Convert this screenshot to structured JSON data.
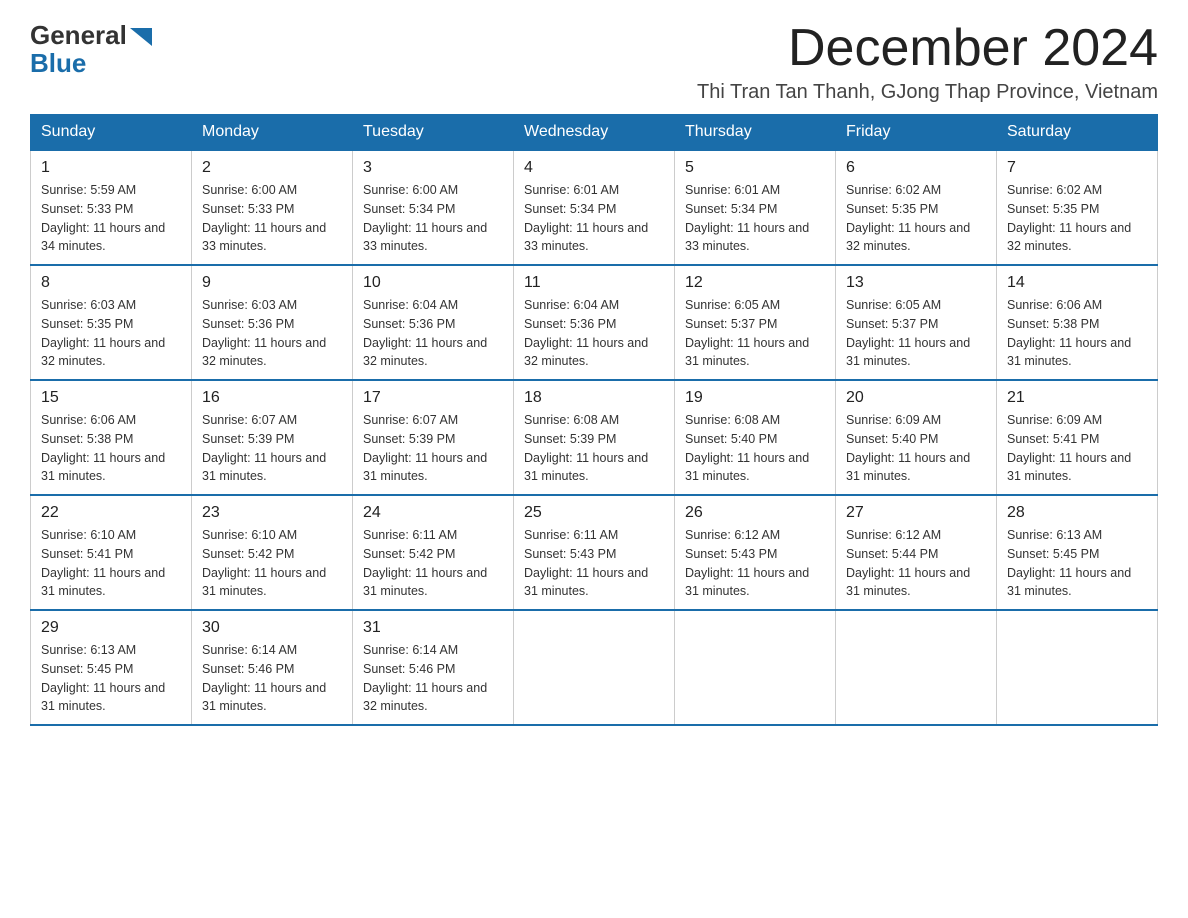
{
  "logo": {
    "general": "General",
    "blue": "Blue"
  },
  "header": {
    "month_title": "December 2024",
    "location": "Thi Tran Tan Thanh, GJong Thap Province, Vietnam"
  },
  "days_of_week": [
    "Sunday",
    "Monday",
    "Tuesday",
    "Wednesday",
    "Thursday",
    "Friday",
    "Saturday"
  ],
  "weeks": [
    [
      {
        "day": "1",
        "sunrise": "5:59 AM",
        "sunset": "5:33 PM",
        "daylight": "11 hours and 34 minutes."
      },
      {
        "day": "2",
        "sunrise": "6:00 AM",
        "sunset": "5:33 PM",
        "daylight": "11 hours and 33 minutes."
      },
      {
        "day": "3",
        "sunrise": "6:00 AM",
        "sunset": "5:34 PM",
        "daylight": "11 hours and 33 minutes."
      },
      {
        "day": "4",
        "sunrise": "6:01 AM",
        "sunset": "5:34 PM",
        "daylight": "11 hours and 33 minutes."
      },
      {
        "day": "5",
        "sunrise": "6:01 AM",
        "sunset": "5:34 PM",
        "daylight": "11 hours and 33 minutes."
      },
      {
        "day": "6",
        "sunrise": "6:02 AM",
        "sunset": "5:35 PM",
        "daylight": "11 hours and 32 minutes."
      },
      {
        "day": "7",
        "sunrise": "6:02 AM",
        "sunset": "5:35 PM",
        "daylight": "11 hours and 32 minutes."
      }
    ],
    [
      {
        "day": "8",
        "sunrise": "6:03 AM",
        "sunset": "5:35 PM",
        "daylight": "11 hours and 32 minutes."
      },
      {
        "day": "9",
        "sunrise": "6:03 AM",
        "sunset": "5:36 PM",
        "daylight": "11 hours and 32 minutes."
      },
      {
        "day": "10",
        "sunrise": "6:04 AM",
        "sunset": "5:36 PM",
        "daylight": "11 hours and 32 minutes."
      },
      {
        "day": "11",
        "sunrise": "6:04 AM",
        "sunset": "5:36 PM",
        "daylight": "11 hours and 32 minutes."
      },
      {
        "day": "12",
        "sunrise": "6:05 AM",
        "sunset": "5:37 PM",
        "daylight": "11 hours and 31 minutes."
      },
      {
        "day": "13",
        "sunrise": "6:05 AM",
        "sunset": "5:37 PM",
        "daylight": "11 hours and 31 minutes."
      },
      {
        "day": "14",
        "sunrise": "6:06 AM",
        "sunset": "5:38 PM",
        "daylight": "11 hours and 31 minutes."
      }
    ],
    [
      {
        "day": "15",
        "sunrise": "6:06 AM",
        "sunset": "5:38 PM",
        "daylight": "11 hours and 31 minutes."
      },
      {
        "day": "16",
        "sunrise": "6:07 AM",
        "sunset": "5:39 PM",
        "daylight": "11 hours and 31 minutes."
      },
      {
        "day": "17",
        "sunrise": "6:07 AM",
        "sunset": "5:39 PM",
        "daylight": "11 hours and 31 minutes."
      },
      {
        "day": "18",
        "sunrise": "6:08 AM",
        "sunset": "5:39 PM",
        "daylight": "11 hours and 31 minutes."
      },
      {
        "day": "19",
        "sunrise": "6:08 AM",
        "sunset": "5:40 PM",
        "daylight": "11 hours and 31 minutes."
      },
      {
        "day": "20",
        "sunrise": "6:09 AM",
        "sunset": "5:40 PM",
        "daylight": "11 hours and 31 minutes."
      },
      {
        "day": "21",
        "sunrise": "6:09 AM",
        "sunset": "5:41 PM",
        "daylight": "11 hours and 31 minutes."
      }
    ],
    [
      {
        "day": "22",
        "sunrise": "6:10 AM",
        "sunset": "5:41 PM",
        "daylight": "11 hours and 31 minutes."
      },
      {
        "day": "23",
        "sunrise": "6:10 AM",
        "sunset": "5:42 PM",
        "daylight": "11 hours and 31 minutes."
      },
      {
        "day": "24",
        "sunrise": "6:11 AM",
        "sunset": "5:42 PM",
        "daylight": "11 hours and 31 minutes."
      },
      {
        "day": "25",
        "sunrise": "6:11 AM",
        "sunset": "5:43 PM",
        "daylight": "11 hours and 31 minutes."
      },
      {
        "day": "26",
        "sunrise": "6:12 AM",
        "sunset": "5:43 PM",
        "daylight": "11 hours and 31 minutes."
      },
      {
        "day": "27",
        "sunrise": "6:12 AM",
        "sunset": "5:44 PM",
        "daylight": "11 hours and 31 minutes."
      },
      {
        "day": "28",
        "sunrise": "6:13 AM",
        "sunset": "5:45 PM",
        "daylight": "11 hours and 31 minutes."
      }
    ],
    [
      {
        "day": "29",
        "sunrise": "6:13 AM",
        "sunset": "5:45 PM",
        "daylight": "11 hours and 31 minutes."
      },
      {
        "day": "30",
        "sunrise": "6:14 AM",
        "sunset": "5:46 PM",
        "daylight": "11 hours and 31 minutes."
      },
      {
        "day": "31",
        "sunrise": "6:14 AM",
        "sunset": "5:46 PM",
        "daylight": "11 hours and 32 minutes."
      },
      null,
      null,
      null,
      null
    ]
  ],
  "labels": {
    "sunrise_prefix": "Sunrise: ",
    "sunset_prefix": "Sunset: ",
    "daylight_prefix": "Daylight: "
  }
}
